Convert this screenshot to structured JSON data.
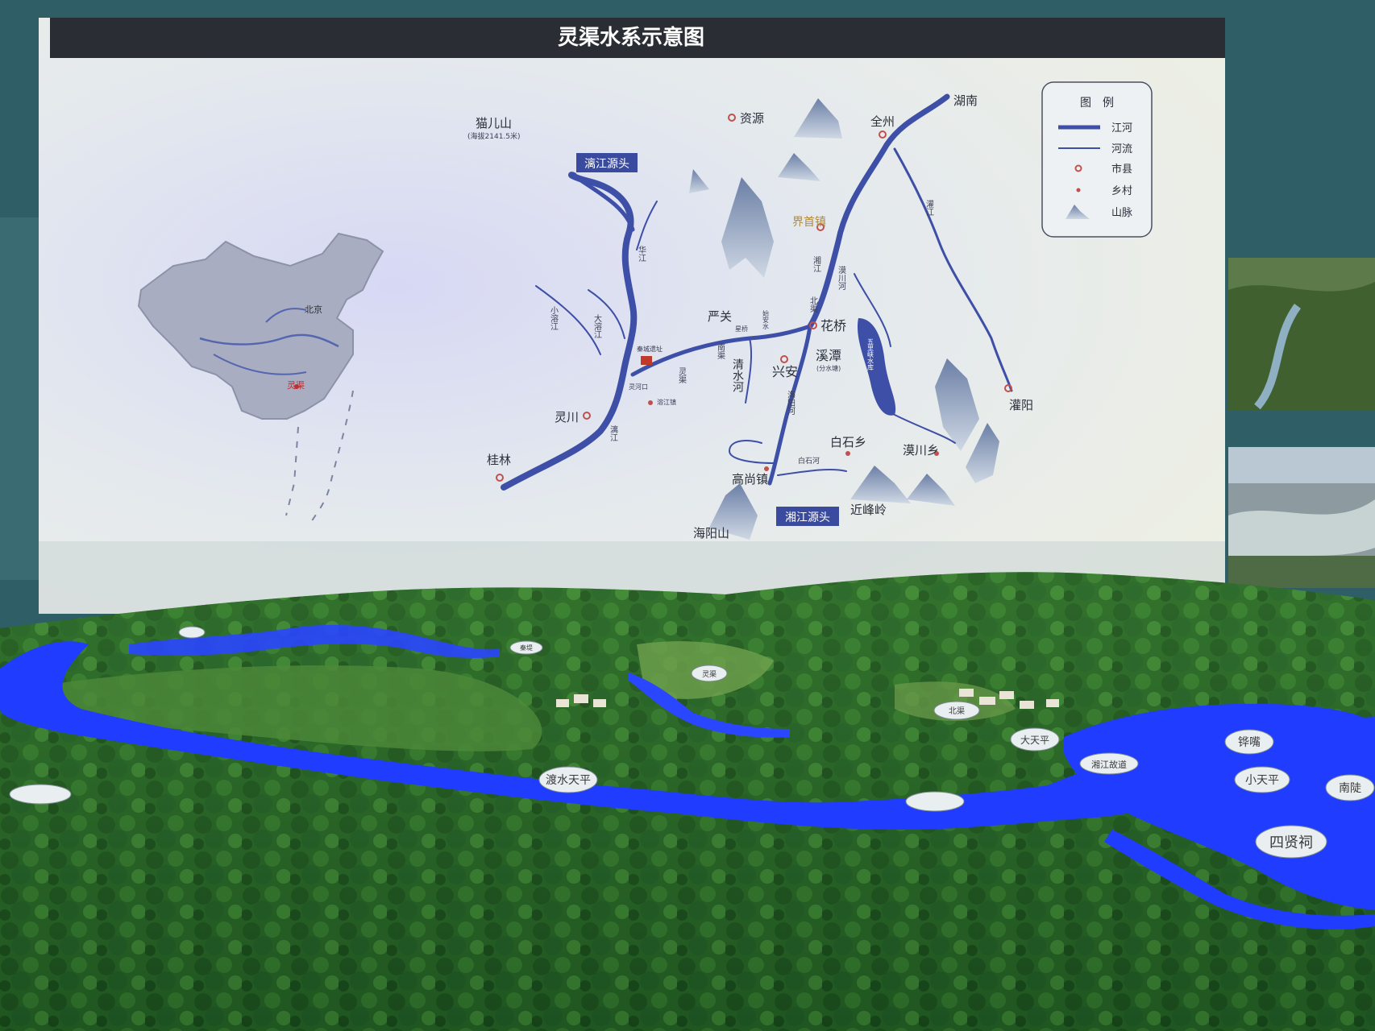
{
  "map": {
    "title": "灵渠水系示意图",
    "legend": {
      "heading": "图　例",
      "items": [
        {
          "label": "江河",
          "icon": "river-thick-line"
        },
        {
          "label": "河流",
          "icon": "river-thin-line"
        },
        {
          "label": "市县",
          "icon": "city-ring-marker"
        },
        {
          "label": "乡村",
          "icon": "village-dot-marker"
        },
        {
          "label": "山脉",
          "icon": "mountain-icon"
        }
      ]
    },
    "places": {
      "maoershan": "猫儿山",
      "maoershan_note": "(海拔2141.5米)",
      "ziyuan": "资源",
      "quanzhou": "全州",
      "hunan": "湖南",
      "jieshou": "界首镇",
      "yanguan": "严关",
      "huaqiao": "花桥",
      "xingan": "兴安",
      "xitan": "溪潭",
      "xitan_note": "(分水塘)",
      "lingchuan": "灵川",
      "guilin": "桂林",
      "guanyang": "灌阳",
      "baishi": "白石乡",
      "shuichuan": "漠川乡",
      "gaoshang": "高尚镇",
      "haiyangshan": "海阳山",
      "jinfengling": "近峰岭",
      "qinchengyizhi": "秦城遗址",
      "shaowangzhen": "溶江镇",
      "ronghekou": "灵河口",
      "baishihe": "白石河",
      "qingshuihe": "清水河",
      "shibuqiao": "星桥",
      "shiyan": "始安水"
    },
    "source_labels": {
      "lijiang": "漓江源头",
      "xiangjiang": "湘江源头"
    },
    "river_labels": {
      "hua_jiang": "华江",
      "xiao_rong_jiang": "小溶江",
      "da_rong_jiang": "大溶江",
      "li_jiang": "漓江",
      "xiang_jiang": "湘江",
      "hai_yang_he": "海阳河",
      "guan_jiang": "灌江",
      "bei_qu": "北渠",
      "nan_qu": "南渠",
      "ling_qu": "灵渠",
      "hai_jiang": "漠川河",
      "lake": "五里峡水库"
    },
    "inset": {
      "beijing": "北京",
      "lingqu": "灵渠"
    }
  },
  "model_labels": [
    "渡水天平",
    "大天平",
    "小天平",
    "南陡",
    "四贤祠",
    "铧嘴",
    "湘江故道",
    "北渠",
    "灵渠",
    "秦堤"
  ],
  "colors": {
    "wall": "#2f5e66",
    "board": "#e7edee",
    "title_bar": "#2a2d33",
    "river": "#3d4fa6",
    "model_water": "#1f3cff",
    "vegetation": "#2d6b2b",
    "source_label_bg": "#3a4a9e"
  }
}
